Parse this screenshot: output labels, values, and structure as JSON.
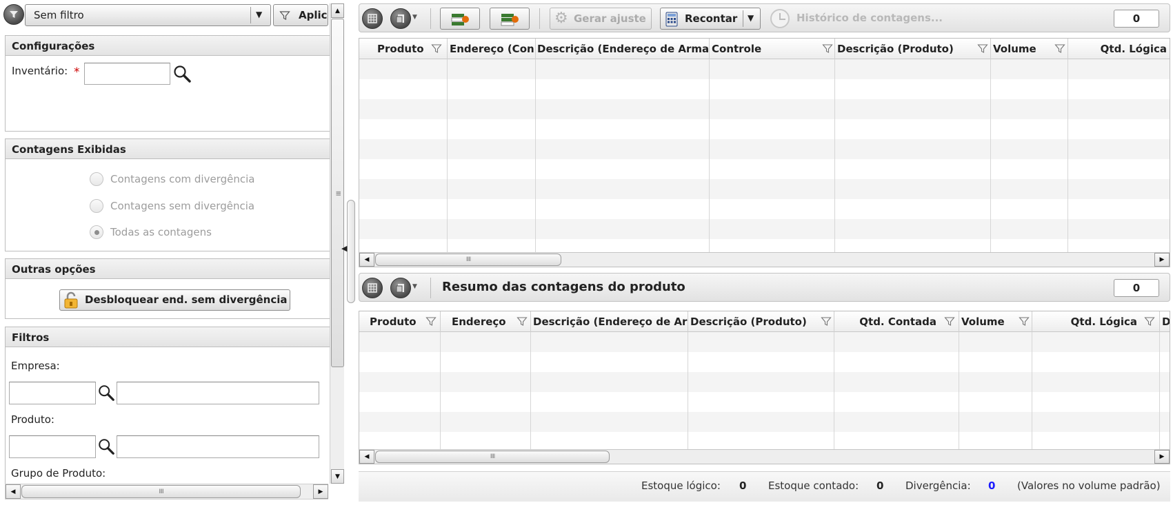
{
  "filter_bar": {
    "selected": "Sem filtro",
    "apply_label": "Aplic"
  },
  "config": {
    "title": "Configurações",
    "inventory_label": "Inventário:",
    "required_mark": "*",
    "inventory_value": ""
  },
  "counts_shown": {
    "title": "Contagens Exibidas",
    "options": [
      {
        "label": "Contagens com divergência",
        "selected": false
      },
      {
        "label": "Contagens sem divergência",
        "selected": false
      },
      {
        "label": "Todas as contagens",
        "selected": true
      }
    ]
  },
  "other_options": {
    "title": "Outras opções",
    "unlock_label": "Desbloquear end. sem divergência"
  },
  "filters": {
    "title": "Filtros",
    "company_label": "Empresa:",
    "product_label": "Produto:",
    "product_group_label": "Grupo de Produto:"
  },
  "top_toolbar": {
    "generate_label": "Gerar ajuste",
    "recount_label": "Recontar",
    "history_label": "Histórico de contagens...",
    "counter": "0"
  },
  "top_grid": {
    "columns": [
      "Produto",
      "Endereço (Con",
      "Descrição (Endereço de Arma",
      "Controle",
      "Descrição (Produto)",
      "Volume",
      "Qtd. Lógica"
    ]
  },
  "bottom_toolbar": {
    "title": "Resumo das contagens do produto",
    "counter": "0"
  },
  "bottom_grid": {
    "columns": [
      "Produto",
      "Endereço",
      "Descrição (Endereço de Ar",
      "Descrição (Produto)",
      "Qtd. Contada",
      "Volume",
      "Qtd. Lógica",
      "Des"
    ]
  },
  "footer": {
    "logical_label": "Estoque lógico:",
    "logical_value": "0",
    "counted_label": "Estoque contado:",
    "counted_value": "0",
    "divergence_label": "Divergência:",
    "divergence_value": "0",
    "note": "(Valores no volume padrão)"
  },
  "colors": {
    "required": "#cc0000",
    "divergence_value": "#1a1aff",
    "stripe": "#f4f4f4"
  }
}
